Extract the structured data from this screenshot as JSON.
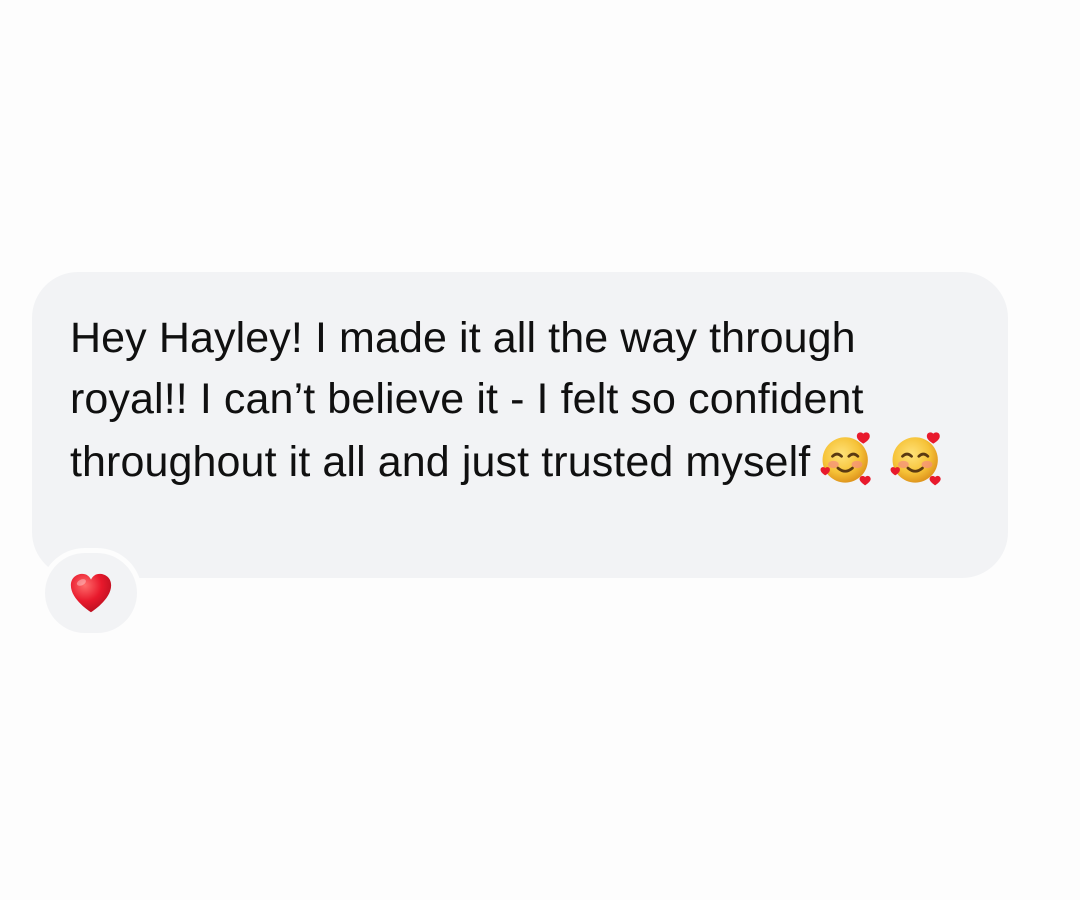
{
  "message": {
    "text": "Hey Hayley! I made it all the way through royal!! I can’t believe it - I felt so confident throughout it all and just trusted myself",
    "emojis": [
      "smiling-face-with-hearts-icon",
      "smiling-face-with-hearts-icon"
    ]
  },
  "reaction": {
    "icon": "red-heart-icon"
  },
  "colors": {
    "background": "#fdfdfd",
    "bubble": "#f2f3f5",
    "text": "#101010",
    "heart": "#e8192c",
    "emoji_face": "#f6c338"
  }
}
